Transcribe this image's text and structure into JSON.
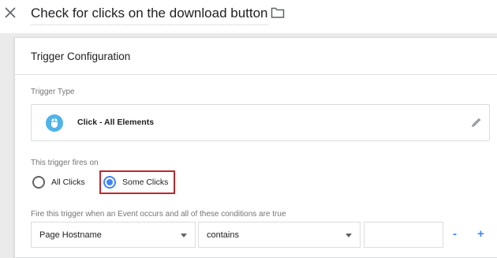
{
  "header": {
    "title": "Check for clicks on the download button",
    "close_icon": "close-icon",
    "folder_icon": "folder-icon"
  },
  "card": {
    "title": "Trigger Configuration",
    "trigger_type_label": "Trigger Type",
    "trigger_type_value": "Click - All Elements",
    "trigger_icon": "mouse-icon",
    "edit_icon": "pencil-icon",
    "fires_on_label": "This trigger fires on",
    "fires_on_options": [
      {
        "label": "All Clicks",
        "selected": false
      },
      {
        "label": "Some Clicks",
        "selected": true
      }
    ],
    "conditions_label": "Fire this trigger when an Event occurs and all of these conditions are true",
    "condition": {
      "variable": "Page Hostname",
      "operator": "contains",
      "value": ""
    },
    "remove_label": "-",
    "add_label": "+"
  },
  "colors": {
    "accent": "#4285f4",
    "highlight": "#c1272d",
    "mouse_badge": "#4fb3e8"
  }
}
